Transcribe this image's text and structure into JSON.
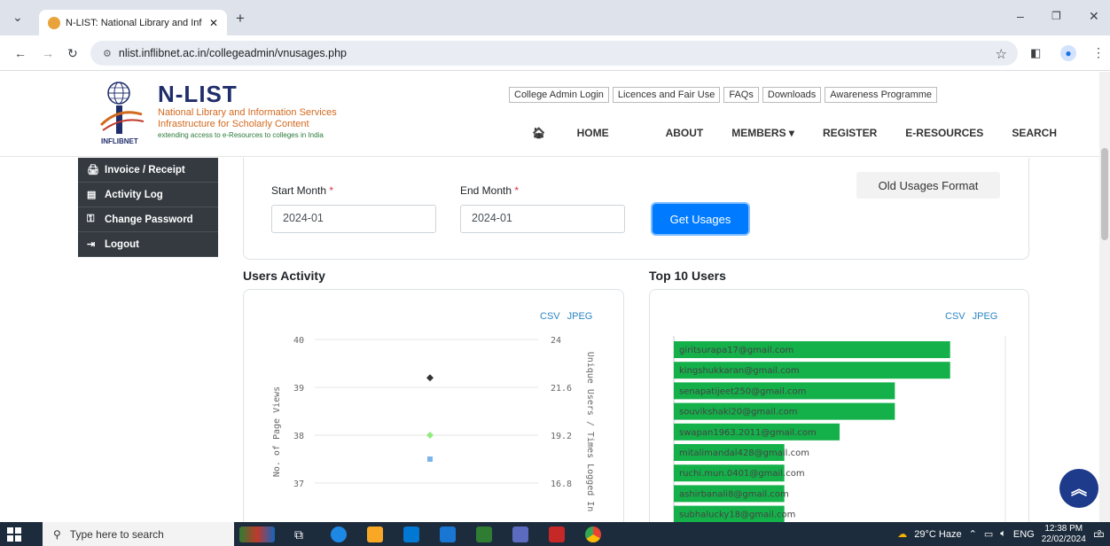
{
  "browser": {
    "tab_title": "N-LIST: National Library and Inf",
    "tab_close": "✕",
    "new_tab": "+",
    "url": "nlist.inflibnet.ac.in/collegeadmin/vnusages.php"
  },
  "header": {
    "logo_org": "INFLIBNET",
    "brand_name": "N-LIST",
    "line1": "National Library and Information Services",
    "line2": "Infrastructure for Scholarly Content",
    "tagline": "extending access to e-Resources to colleges in India",
    "top_links": [
      "College Admin Login",
      "Licences and Fair Use",
      "FAQs",
      "Downloads",
      "Awareness Programme"
    ],
    "nav": [
      "HOME",
      "ABOUT",
      "MEMBERS ▾",
      "REGISTER",
      "E-RESOURCES",
      "SEARCH"
    ]
  },
  "sidebar": {
    "items": [
      {
        "label": "Invoice / Receipt",
        "icon": "print-icon"
      },
      {
        "label": "Activity Log",
        "icon": "list-icon"
      },
      {
        "label": "Change Password",
        "icon": "key-icon"
      },
      {
        "label": "Logout",
        "icon": "logout-icon"
      }
    ]
  },
  "form": {
    "start_label": "Start Month",
    "end_label": "End Month",
    "required_mark": "*",
    "start_value": "2024-01",
    "end_value": "2024-01",
    "get_button": "Get Usages",
    "old_button": "Old Usages Format"
  },
  "users_activity": {
    "title": "Users Activity",
    "csv": "CSV",
    "jpeg": "JPEG",
    "y_left_label": "No. of Page Views",
    "y_right_label": "Unique Users / Times Logged In",
    "left_ticks": [
      "40",
      "39",
      "38",
      "37"
    ],
    "right_ticks": [
      "24",
      "21.6",
      "19.2",
      "16.8"
    ]
  },
  "top_users": {
    "title": "Top 10 Users",
    "csv": "CSV",
    "jpeg": "JPEG"
  },
  "chart_data": [
    {
      "type": "scatter",
      "title": "Users Activity",
      "ylabel": "No. of Page Views",
      "y2label": "Unique Users / Times Logged In",
      "ylim": [
        37,
        40
      ],
      "y2lim": [
        16.8,
        24
      ],
      "series": [
        {
          "values": [
            39.2
          ],
          "axis": "left",
          "color": "#333333",
          "marker": "diamond"
        },
        {
          "values": [
            38.0
          ],
          "axis": "left",
          "color": "#90ed7d",
          "marker": "diamond"
        },
        {
          "values": [
            37.5
          ],
          "axis": "left",
          "color": "#7cb5ec",
          "marker": "square"
        }
      ]
    },
    {
      "type": "bar",
      "orientation": "horizontal",
      "title": "Top 10 Users",
      "categories": [
        "giritsurapa17@gmail.com",
        "kingshukkaran@gmail.com",
        "senapatijeet250@gmail.com",
        "souvikshaki20@gmail.com",
        "swapan1963.2011@gmail.com",
        "mitalimandal428@gmail.com",
        "ruchi.mun.0401@gmail.com",
        "ashirbanali8@gmail.com",
        "subhalucky18@gmail.com"
      ],
      "values": [
        10,
        10,
        8,
        8,
        6,
        4,
        4,
        4,
        4
      ],
      "xlim": [
        0,
        12
      ],
      "color": "#14b04a"
    }
  ],
  "taskbar": {
    "search_placeholder": "Type here to search",
    "weather": "29°C Haze",
    "lang": "ENG",
    "time": "12:38 PM",
    "date": "22/02/2024",
    "notif_count": "2"
  }
}
